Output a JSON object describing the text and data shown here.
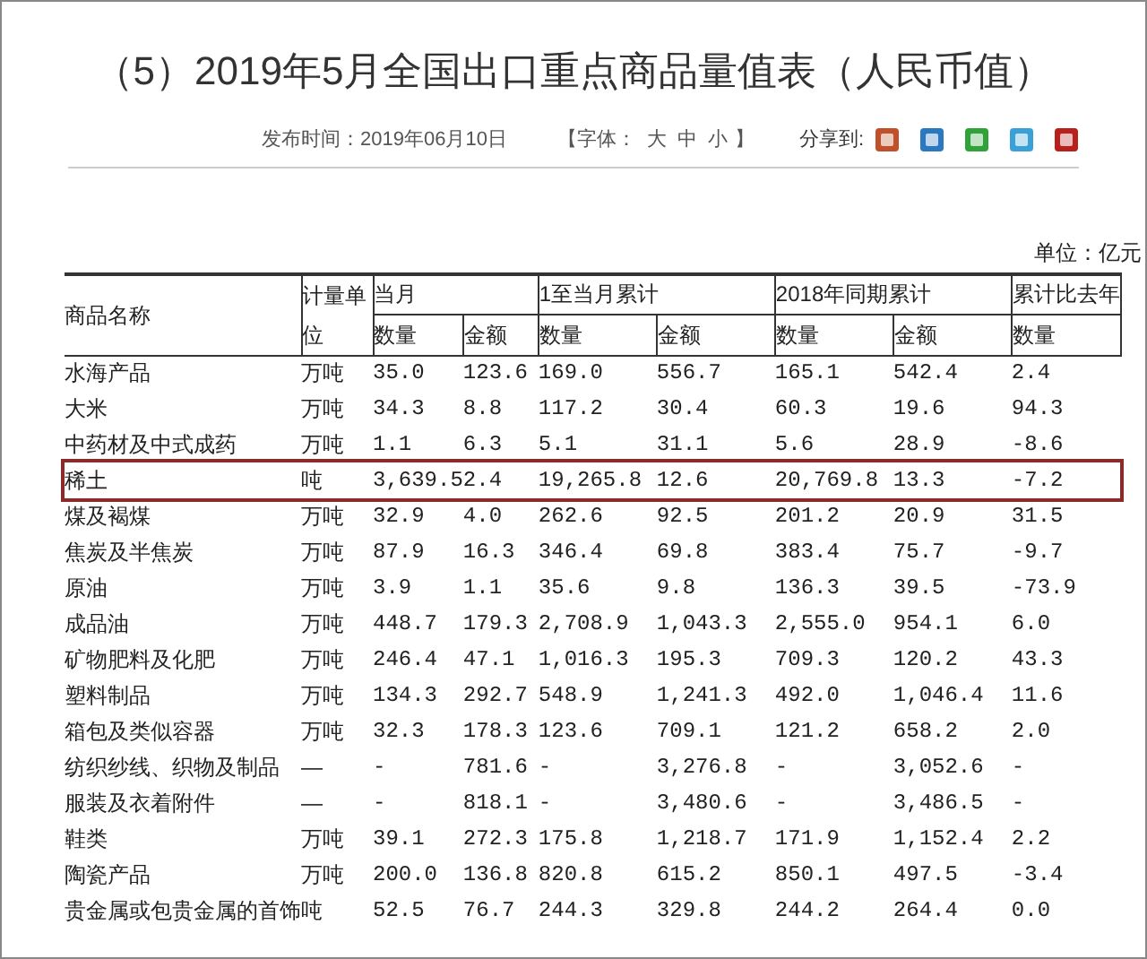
{
  "title": "（5）2019年5月全国出口重点商品量值表（人民币值）",
  "meta": {
    "published": "发布时间：2019年06月10日",
    "font_label": "【字体：",
    "font_sizes": [
      "大",
      "中",
      "小"
    ],
    "font_close": "】",
    "share_label": "分享到:"
  },
  "unit_note": "单位：亿元",
  "table": {
    "name_header": "商品名称",
    "unit_header": "计量单位",
    "groups": [
      {
        "label": "当月",
        "columns": [
          "数量",
          "金额"
        ]
      },
      {
        "label": "1至当月累计",
        "columns": [
          "数量",
          "金额"
        ]
      },
      {
        "label": "2018年同期累计",
        "columns": [
          "数量",
          "金额"
        ]
      },
      {
        "label": "累计比去年",
        "columns": [
          "数量"
        ]
      }
    ],
    "rows": [
      {
        "name": "水海产品",
        "unit": "万吨",
        "values": [
          "35.0",
          "123.6",
          "169.0",
          "556.7",
          "165.1",
          "542.4",
          "2.4"
        ],
        "highlighted": false
      },
      {
        "name": "大米",
        "unit": "万吨",
        "values": [
          "34.3",
          "8.8",
          "117.2",
          "30.4",
          "60.3",
          "19.6",
          "94.3"
        ],
        "highlighted": false
      },
      {
        "name": "中药材及中式成药",
        "unit": "万吨",
        "values": [
          "1.1",
          "6.3",
          "5.1",
          "31.1",
          "5.6",
          "28.9",
          "-8.6"
        ],
        "highlighted": false
      },
      {
        "name": "稀土",
        "unit": "吨",
        "values": [
          "3,639.5",
          "2.4",
          "19,265.8",
          "12.6",
          "20,769.8",
          "13.3",
          "-7.2"
        ],
        "highlighted": true
      },
      {
        "name": "煤及褐煤",
        "unit": "万吨",
        "values": [
          "32.9",
          "4.0",
          "262.6",
          "92.5",
          "201.2",
          "20.9",
          "31.5"
        ],
        "highlighted": false
      },
      {
        "name": "焦炭及半焦炭",
        "unit": "万吨",
        "values": [
          "87.9",
          "16.3",
          "346.4",
          "69.8",
          "383.4",
          "75.7",
          "-9.7"
        ],
        "highlighted": false
      },
      {
        "name": "原油",
        "unit": "万吨",
        "values": [
          "3.9",
          "1.1",
          "35.6",
          "9.8",
          "136.3",
          "39.5",
          "-73.9"
        ],
        "highlighted": false
      },
      {
        "name": "成品油",
        "unit": "万吨",
        "values": [
          "448.7",
          "179.3",
          "2,708.9",
          "1,043.3",
          "2,555.0",
          "954.1",
          "6.0"
        ],
        "highlighted": false
      },
      {
        "name": "矿物肥料及化肥",
        "unit": "万吨",
        "values": [
          "246.4",
          "47.1",
          "1,016.3",
          "195.3",
          "709.3",
          "120.2",
          "43.3"
        ],
        "highlighted": false
      },
      {
        "name": "塑料制品",
        "unit": "万吨",
        "values": [
          "134.3",
          "292.7",
          "548.9",
          "1,241.3",
          "492.0",
          "1,046.4",
          "11.6"
        ],
        "highlighted": false
      },
      {
        "name": "箱包及类似容器",
        "unit": "万吨",
        "values": [
          "32.3",
          "178.3",
          "123.6",
          "709.1",
          "121.2",
          "658.2",
          "2.0"
        ],
        "highlighted": false
      },
      {
        "name": "纺织纱线、织物及制品",
        "unit": "—",
        "values": [
          "-",
          "781.6",
          "-",
          "3,276.8",
          "-",
          "3,052.6",
          "-"
        ],
        "highlighted": false
      },
      {
        "name": "服装及衣着附件",
        "unit": "—",
        "values": [
          "-",
          "818.1",
          "-",
          "3,480.6",
          "-",
          "3,486.5",
          "-"
        ],
        "highlighted": false
      },
      {
        "name": "鞋类",
        "unit": "万吨",
        "values": [
          "39.1",
          "272.3",
          "175.8",
          "1,218.7",
          "171.9",
          "1,152.4",
          "2.2"
        ],
        "highlighted": false
      },
      {
        "name": "陶瓷产品",
        "unit": "万吨",
        "values": [
          "200.0",
          "136.8",
          "820.8",
          "615.2",
          "850.1",
          "497.5",
          "-3.4"
        ],
        "highlighted": false
      },
      {
        "name": "贵金属或包贵金属的首饰",
        "unit": "吨",
        "values": [
          "52.5",
          "76.7",
          "244.3",
          "329.8",
          "244.2",
          "264.4",
          "0.0"
        ],
        "highlighted": false
      }
    ]
  }
}
